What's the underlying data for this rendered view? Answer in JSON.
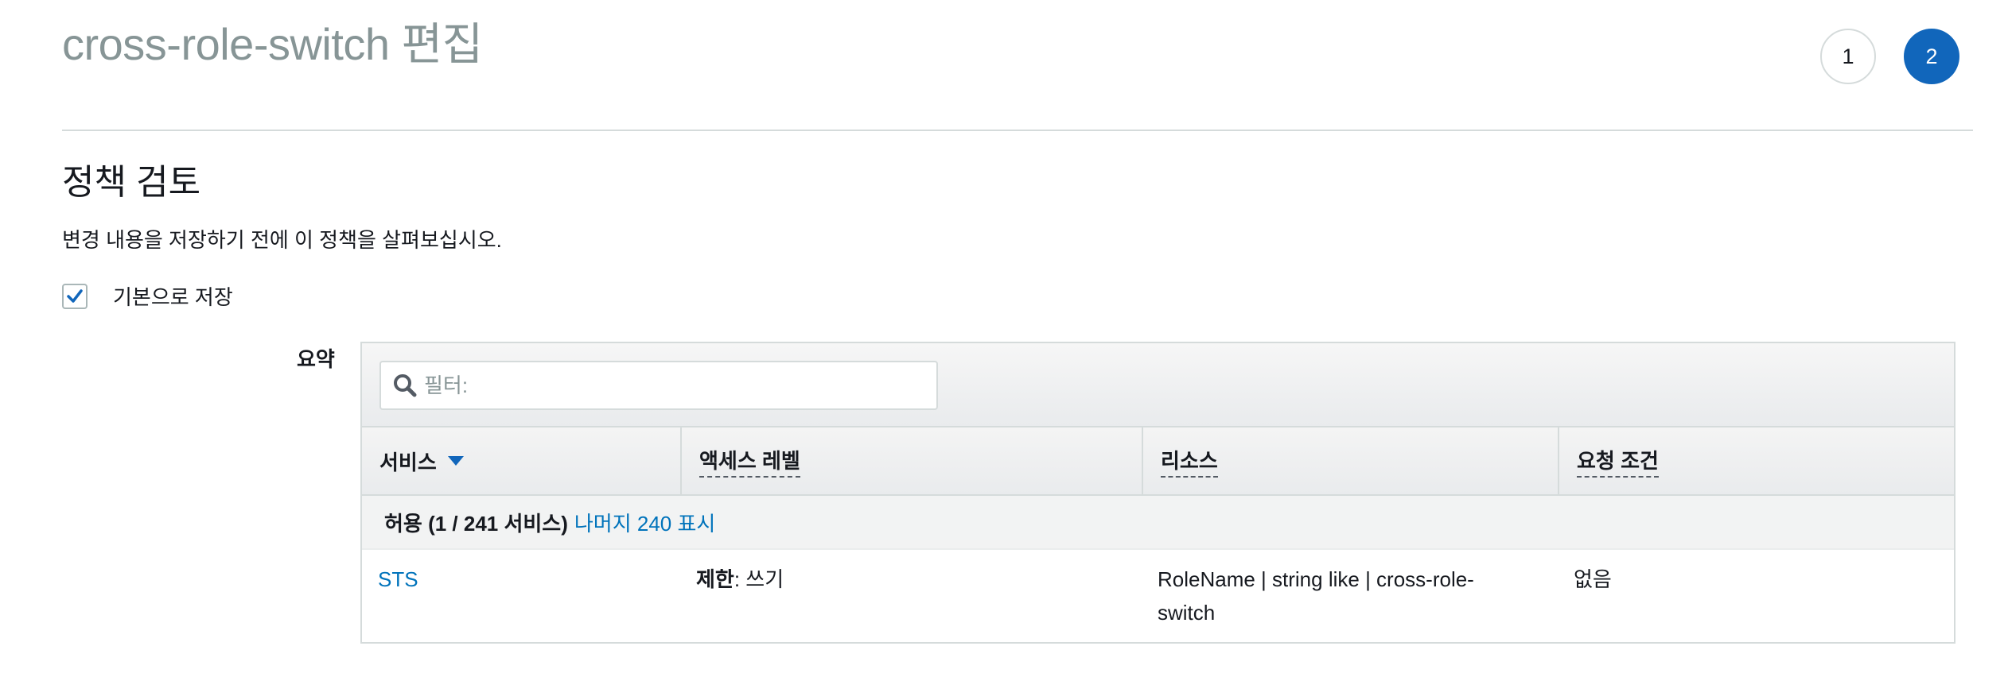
{
  "header": {
    "title": "cross-role-switch 편집",
    "steps": [
      "1",
      "2"
    ]
  },
  "review": {
    "title": "정책 검토",
    "description": "변경 내용을 저장하기 전에 이 정책을 살펴보십시오.",
    "save_as_default": {
      "label": "기본으로 저장",
      "checked": true
    }
  },
  "summary": {
    "label": "요약",
    "filter_placeholder": "필터:",
    "columns": [
      "서비스",
      "액세스 레벨",
      "리소스",
      "요청 조건"
    ],
    "group": {
      "title": "허용 (1 / 241 서비스)",
      "link": "나머지 240 표시"
    },
    "rows": [
      {
        "service": "STS",
        "access_level_bold": "제한",
        "access_level_rest": ": 쓰기",
        "resource": "RoleName | string like | cross-role-switch",
        "conditions": "없음"
      }
    ]
  },
  "colors": {
    "accent": "#1166bb",
    "link": "#0073bb",
    "title_gray": "#879596",
    "border": "#d5dbdb"
  }
}
